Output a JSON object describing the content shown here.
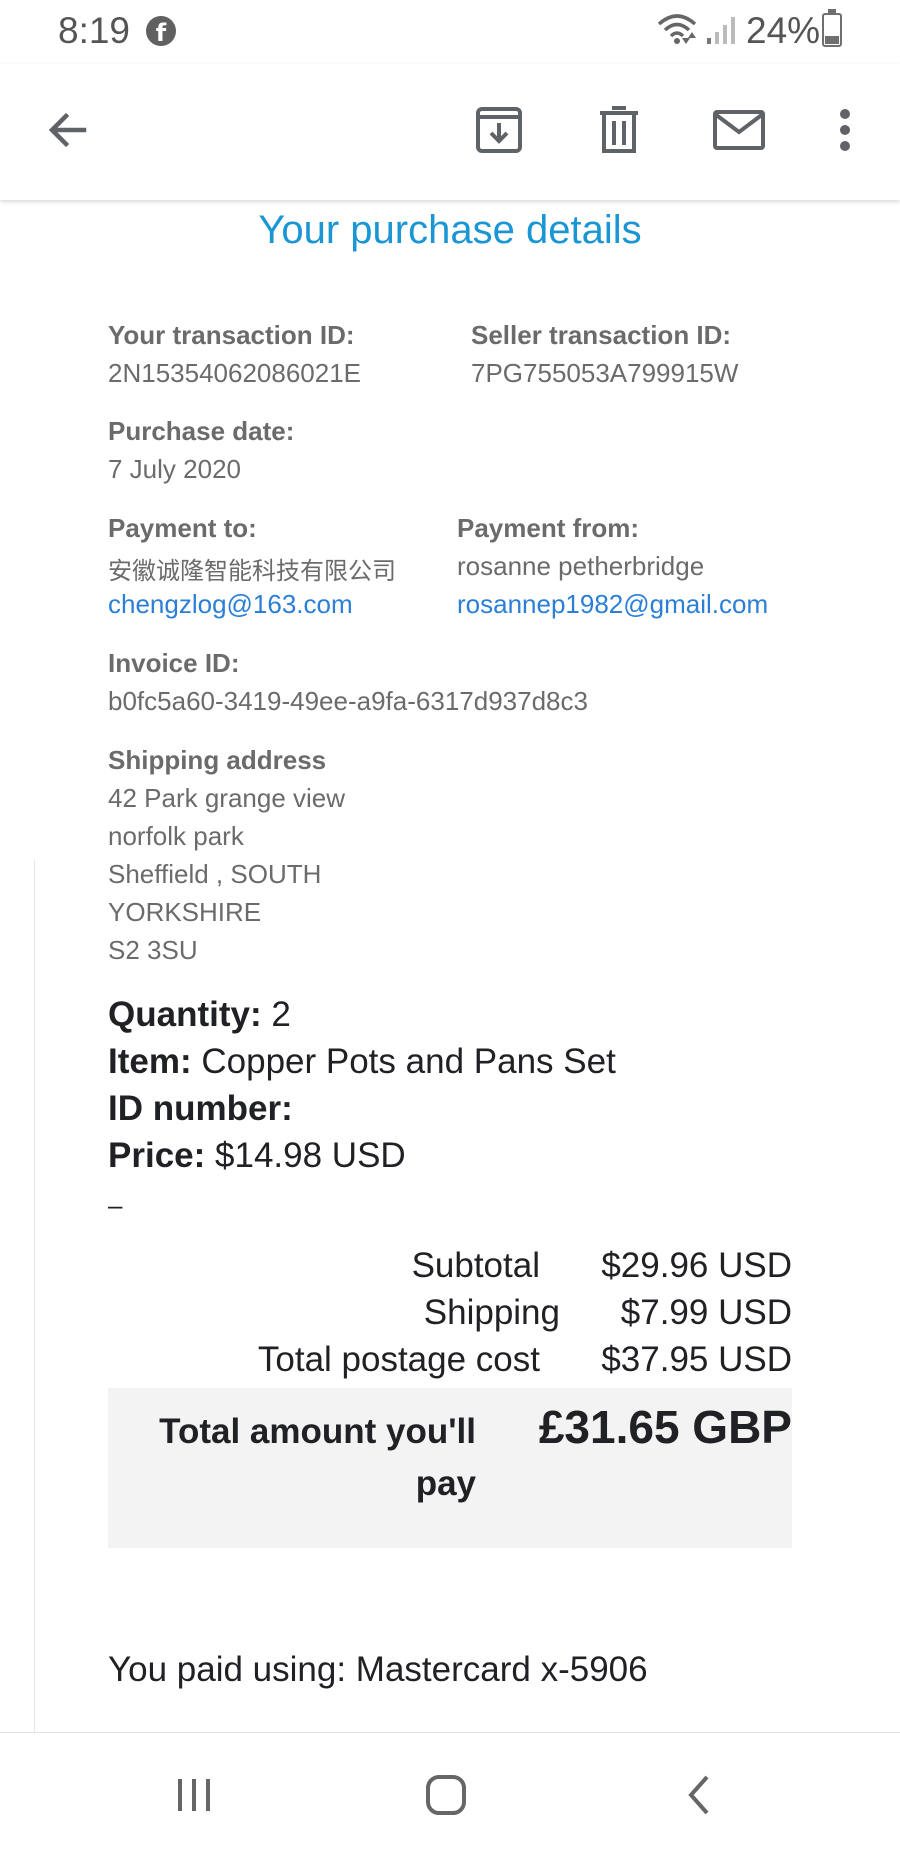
{
  "status_bar": {
    "time": "8:19",
    "battery": "24%",
    "icons": [
      "facebook-icon",
      "wifi-icon",
      "signal-icon",
      "battery-icon"
    ]
  },
  "toolbar": {
    "icons": [
      "back-arrow-icon",
      "archive-icon",
      "trash-icon",
      "mail-icon",
      "more-vert-icon"
    ]
  },
  "email": {
    "heading": "Your purchase details",
    "your_txn_label": "Your transaction ID:",
    "your_txn_value": "2N15354062086021E",
    "seller_txn_label": "Seller transaction ID:",
    "seller_txn_value": "7PG755053A799915W",
    "purchase_date_label": "Purchase date:",
    "purchase_date_value": "7 July 2020",
    "payment_to_label": "Payment to:",
    "payment_to_name": "安徽诚隆智能科技有限公司",
    "payment_to_email": "chengzlog@163.com",
    "payment_from_label": "Payment from:",
    "payment_from_name": "rosanne petherbridge",
    "payment_from_email": "rosannep1982@gmail.com",
    "invoice_label": "Invoice ID:",
    "invoice_value": "b0fc5a60-3419-49ee-a9fa-6317d937d8c3",
    "shipping_label": "Shipping address",
    "address_lines": [
      "42 Park grange view",
      "norfolk park",
      "Sheffield , SOUTH",
      "YORKSHIRE",
      "S2 3SU"
    ],
    "item": {
      "quantity_label": "Quantity:",
      "quantity_value": "2",
      "item_label": "Item:",
      "item_value": "Copper Pots and Pans Set",
      "id_label": "ID number:",
      "price_label": "Price:",
      "price_value": "$14.98 USD"
    },
    "dash": "–",
    "summary": {
      "subtotal_label": "Subtotal",
      "subtotal_value": "$29.96 USD",
      "shipping_label": "Shipping",
      "shipping_value": "$7.99 USD",
      "total_postage_label": "Total postage cost",
      "total_postage_value": "$37.95 USD",
      "total_label": "Total amount you'll pay",
      "total_value": "£31.65 GBP"
    },
    "paid_using": "You paid using: Mastercard x-5906"
  },
  "nav_bar": {
    "icons": [
      "recents-icon",
      "home-icon",
      "back-icon"
    ]
  },
  "colors": {
    "heading": "#1a96d4",
    "link": "#2b7fd6",
    "muted_text": "#6b6b6b",
    "total_box": "#f3f3f3"
  }
}
